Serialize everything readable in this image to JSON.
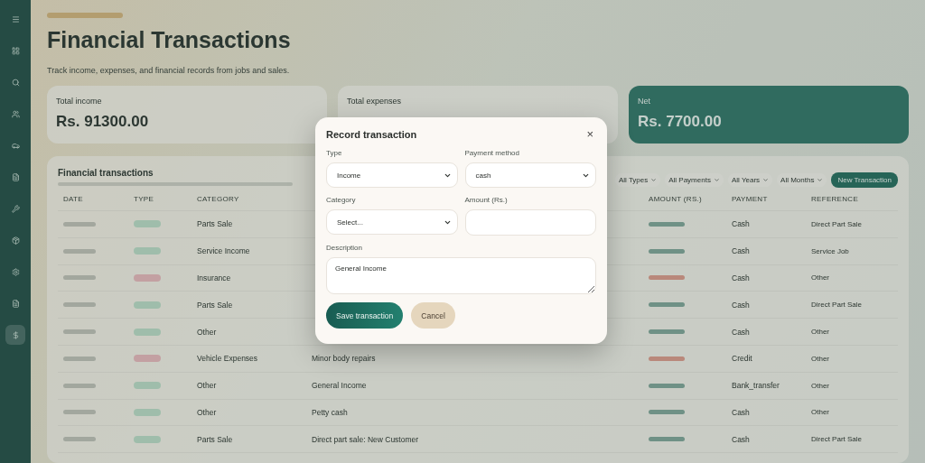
{
  "page": {
    "title": "Financial Transactions",
    "subtitle": "Track income, expenses, and financial records from jobs and sales."
  },
  "summary_cards": [
    {
      "label": "Total income",
      "value": "Rs. 91300.00",
      "kind": "plain"
    },
    {
      "label": "Total expenses",
      "kind": "plain"
    },
    {
      "label": "Net",
      "value": "Rs. 7700.00",
      "kind": "accent"
    }
  ],
  "table": {
    "title": "Financial transactions",
    "filters": [
      "All Types",
      "All Payments",
      "All Years",
      "All Months"
    ],
    "new_button": "New Transaction",
    "columns": [
      "DATE",
      "TYPE",
      "CATEGORY",
      null,
      null,
      "AMOUNT (RS.)",
      "PAYMENT",
      "REFERENCE"
    ],
    "rows": [
      {
        "kind": "income",
        "category": "Parts Sale",
        "payment": "Cash",
        "reference": "Direct Part Sale"
      },
      {
        "kind": "income",
        "category": "Service Income",
        "payment": "Cash",
        "reference": "Service Job"
      },
      {
        "kind": "expense",
        "category": "Insurance",
        "payment": "Cash",
        "reference": "Other"
      },
      {
        "kind": "income",
        "category": "Parts Sale",
        "payment": "Cash",
        "reference": "Direct Part Sale"
      },
      {
        "kind": "income",
        "category": "Other",
        "payment": "Cash",
        "reference": "Other"
      },
      {
        "kind": "expense",
        "category": "Vehicle Expenses",
        "description": "Minor body repairs",
        "payment": "Credit",
        "reference": "Other"
      },
      {
        "kind": "income",
        "category": "Other",
        "description": "General Income",
        "payment": "Bank_transfer",
        "reference": "Other"
      },
      {
        "kind": "income",
        "category": "Other",
        "description": "Petty cash",
        "payment": "Cash",
        "reference": "Other"
      },
      {
        "kind": "income",
        "category": "Parts Sale",
        "description": "Direct part sale: New Customer",
        "payment": "Cash",
        "reference": "Direct Part Sale"
      }
    ]
  },
  "dialog": {
    "title": "Record transaction",
    "close": "×",
    "fields": [
      {
        "kind": "select",
        "label": "Type",
        "value": "Income"
      },
      {
        "kind": "select",
        "label": "Payment method",
        "value": "cash"
      },
      {
        "kind": "select",
        "label": "Category",
        "value": "Select..."
      },
      {
        "kind": "input",
        "label": "Amount (Rs.)"
      },
      {
        "kind": "textarea",
        "label": "Description",
        "value": "General Income"
      }
    ],
    "buttons": [
      {
        "label": "Save transaction",
        "kind": "primary"
      },
      {
        "label": "Cancel",
        "kind": "secondary"
      }
    ]
  }
}
